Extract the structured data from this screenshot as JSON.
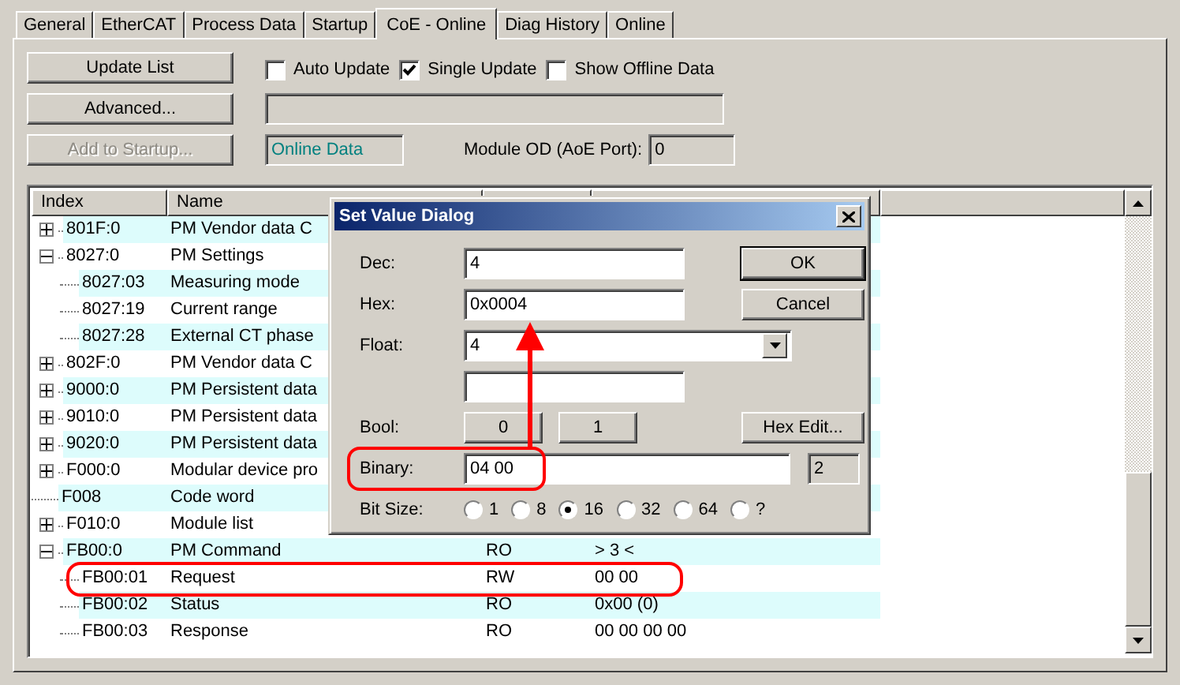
{
  "tabs": [
    {
      "label": "General",
      "selected": false
    },
    {
      "label": "EtherCAT",
      "selected": false
    },
    {
      "label": "Process Data",
      "selected": false
    },
    {
      "label": "Startup",
      "selected": false
    },
    {
      "label": "CoE - Online",
      "selected": true
    },
    {
      "label": "Diag History",
      "selected": false
    },
    {
      "label": "Online",
      "selected": false
    }
  ],
  "buttons": [
    {
      "label": "Update List",
      "disabled": false
    },
    {
      "label": "Advanced...",
      "disabled": false
    },
    {
      "label": "Add to Startup...",
      "disabled": true
    }
  ],
  "options": [
    {
      "label": "Auto Update",
      "checked": false
    },
    {
      "label": "Single Update",
      "checked": true
    },
    {
      "label": "Show Offline Data",
      "checked": false
    }
  ],
  "status_field": "Online Data",
  "module_od": {
    "label": "Module OD (AoE Port):",
    "value": "0"
  },
  "table": {
    "columns": [
      "Index",
      "Name"
    ],
    "rows": [
      {
        "index": "801F:0",
        "name": "PM Vendor data C",
        "expanded": false
      },
      {
        "index": "8027:0",
        "name": "PM Settings",
        "expanded": true,
        "children": [
          {
            "index": "8027:03",
            "name": "Measuring mode"
          },
          {
            "index": "8027:19",
            "name": "Current range"
          },
          {
            "index": "8027:28",
            "name": "External CT phase"
          }
        ]
      },
      {
        "index": "802F:0",
        "name": "PM Vendor data C",
        "expanded": false
      },
      {
        "index": "9000:0",
        "name": "PM Persistent data",
        "expanded": false
      },
      {
        "index": "9010:0",
        "name": "PM Persistent data",
        "expanded": false
      },
      {
        "index": "9020:0",
        "name": "PM Persistent data",
        "expanded": false
      },
      {
        "index": "F000:0",
        "name": "Modular device pro",
        "expanded": false
      },
      {
        "index": "F008",
        "name": "Code word"
      },
      {
        "index": "F010:0",
        "name": "Module list",
        "expanded": false
      },
      {
        "index": "FB00:0",
        "name": "PM Command",
        "flags": "RO",
        "value": "> 3 <",
        "expanded": true,
        "children": [
          {
            "index": "FB00:01",
            "name": "Request",
            "flags": "RW",
            "value": "00 00"
          },
          {
            "index": "FB00:02",
            "name": "Status",
            "flags": "RO",
            "value": "0x00 (0)"
          },
          {
            "index": "FB00:03",
            "name": "Response",
            "flags": "RO",
            "value": "00 00 00 00"
          }
        ]
      }
    ]
  },
  "dialog": {
    "title": "Set Value Dialog",
    "dec": {
      "label": "Dec:",
      "value": "4"
    },
    "hex": {
      "label": "Hex:",
      "value": "0x0004"
    },
    "float": {
      "label": "Float:",
      "value": "4"
    },
    "bool": {
      "label": "Bool:",
      "buttons": [
        "0",
        "1"
      ]
    },
    "ok": "OK",
    "cancel": "Cancel",
    "hex_edit": "Hex Edit...",
    "binary": {
      "label": "Binary:",
      "value": "04 00",
      "length": "2"
    },
    "bit_size": {
      "label": "Bit Size:",
      "options": [
        {
          "label": "1",
          "selected": false
        },
        {
          "label": "8",
          "selected": false
        },
        {
          "label": "16",
          "selected": true
        },
        {
          "label": "32",
          "selected": false
        },
        {
          "label": "64",
          "selected": false
        },
        {
          "label": "?",
          "selected": false
        }
      ]
    }
  }
}
